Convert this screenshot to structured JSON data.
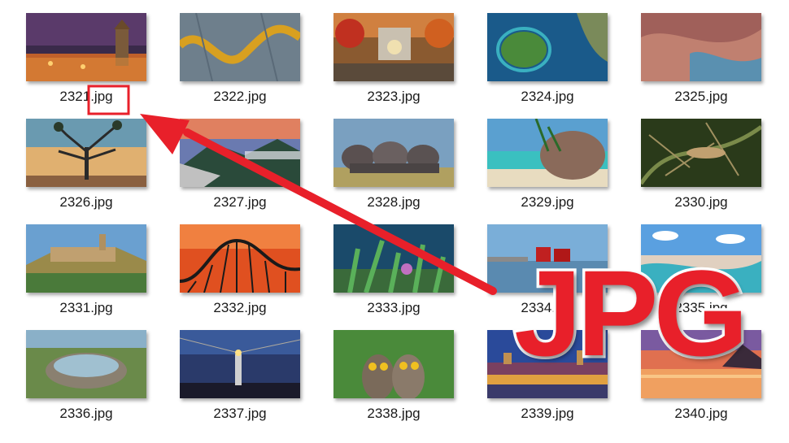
{
  "files": [
    {
      "name": "2321.jpg",
      "thumb": "castle-night"
    },
    {
      "name": "2322.jpg",
      "thumb": "river-aerial"
    },
    {
      "name": "2323.jpg",
      "thumb": "autumn-garden"
    },
    {
      "name": "2324.jpg",
      "thumb": "island-aerial"
    },
    {
      "name": "2325.jpg",
      "thumb": "rock-cave"
    },
    {
      "name": "2326.jpg",
      "thumb": "joshua-tree"
    },
    {
      "name": "2327.jpg",
      "thumb": "mountain-sunset"
    },
    {
      "name": "2328.jpg",
      "thumb": "elephants"
    },
    {
      "name": "2329.jpg",
      "thumb": "tropical-beach"
    },
    {
      "name": "2330.jpg",
      "thumb": "lizard-fern"
    },
    {
      "name": "2331.jpg",
      "thumb": "hill-town"
    },
    {
      "name": "2332.jpg",
      "thumb": "roller-coaster"
    },
    {
      "name": "2333.jpg",
      "thumb": "underwater-plants"
    },
    {
      "name": "2334.jpg",
      "thumb": "harbor-houses"
    },
    {
      "name": "2335.jpg",
      "thumb": "coastal-city"
    },
    {
      "name": "2336.jpg",
      "thumb": "stone-circle"
    },
    {
      "name": "2337.jpg",
      "thumb": "lighthouse"
    },
    {
      "name": "2338.jpg",
      "thumb": "owls"
    },
    {
      "name": "2339.jpg",
      "thumb": "city-lights"
    },
    {
      "name": "2340.jpg",
      "thumb": "bay-dusk"
    }
  ],
  "annotation": {
    "label": "JPG",
    "arrow_color": "#e8202a",
    "highlight_target": "2321.jpg"
  }
}
